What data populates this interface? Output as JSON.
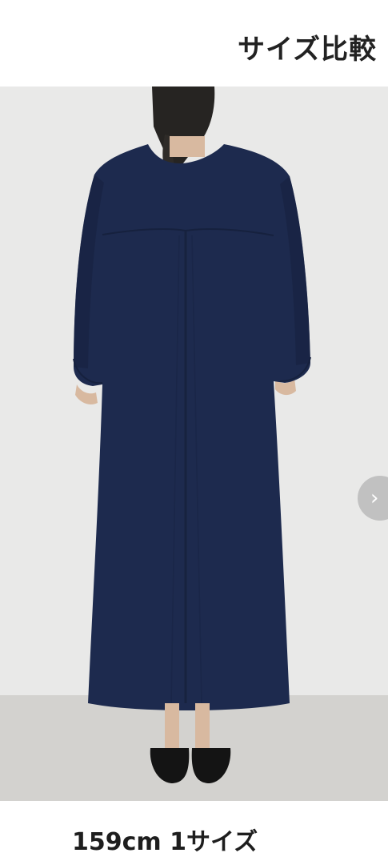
{
  "header": {
    "title": "サイズ比較"
  },
  "product_photo": {
    "subject": "navy dress back view",
    "garment_color": "#1d2a4e",
    "background_color": "#e9e9e8",
    "floor_color": "#d3d2cf"
  },
  "carousel": {
    "next_icon": "chevron-right-icon",
    "next_glyph": "›"
  },
  "caption": {
    "text": "159cm 1サイズ"
  }
}
